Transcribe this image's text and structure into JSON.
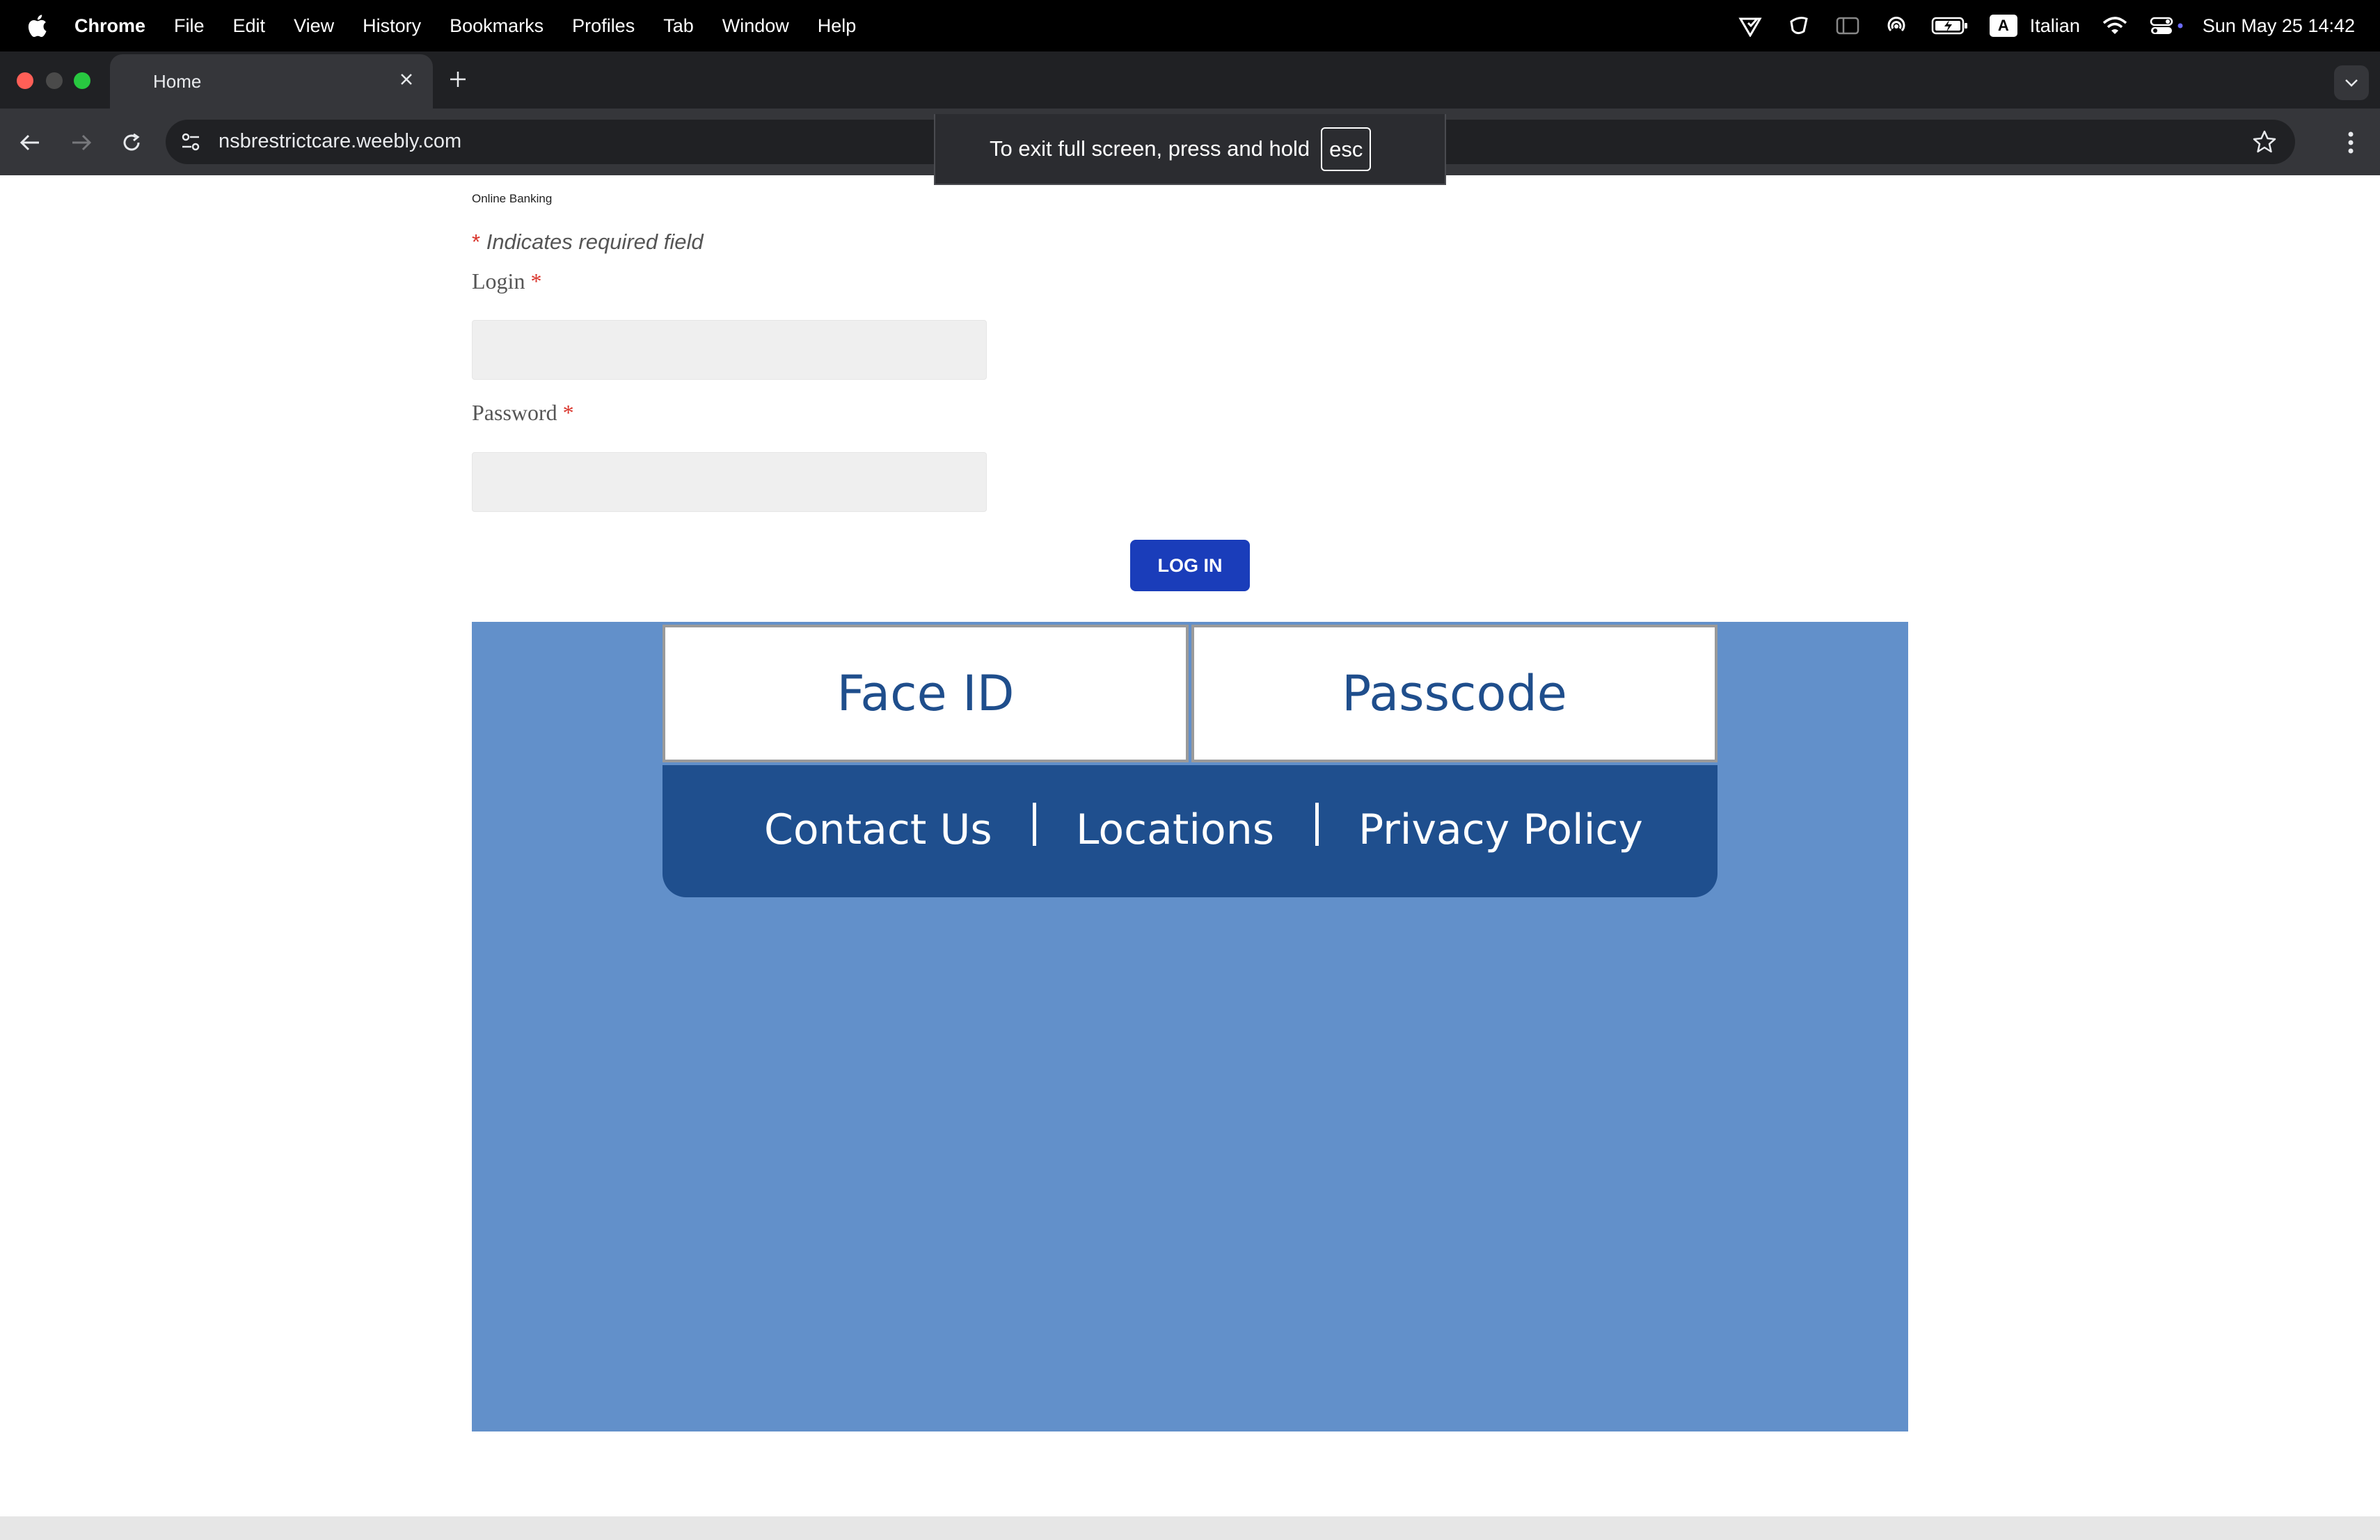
{
  "menubar": {
    "app_name": "Chrome",
    "menus": [
      "File",
      "Edit",
      "View",
      "History",
      "Bookmarks",
      "Profiles",
      "Tab",
      "Window",
      "Help"
    ],
    "input_source": "Italian",
    "input_source_badge": "A",
    "datetime": "Sun May 25  14:42"
  },
  "browser": {
    "tab_title": "Home",
    "url": "nsbrestrictcare.weebly.com",
    "fullscreen_notice": "To exit full screen, press and hold",
    "fullscreen_key": "esc"
  },
  "page": {
    "section_title": "Online Banking",
    "required_note": "Indicates required field",
    "required_marker": "*",
    "login_label": "Login",
    "password_label": "Password",
    "login_value": "",
    "password_value": "",
    "login_button": "LOG IN",
    "auth_options": [
      "Face ID",
      "Passcode"
    ],
    "footer_links": [
      "Contact Us",
      "Locations",
      "Privacy Policy"
    ]
  },
  "colors": {
    "login_button": "#1a3dba",
    "panel_blue": "#6290ca",
    "links_bar": "#1f4f8e",
    "auth_text": "#1f4e8c",
    "required_asterisk": "#d9342b"
  }
}
